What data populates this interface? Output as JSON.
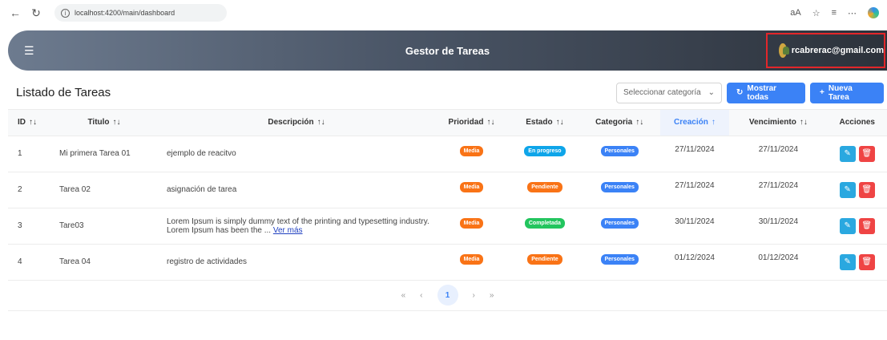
{
  "browser": {
    "url": "localhost:4200/main/dashboard",
    "right_icons": [
      "aA",
      "☆",
      "≡",
      "⋯"
    ]
  },
  "header": {
    "title": "Gestor de Tareas",
    "user_email": "rcabrerac@gmail.com"
  },
  "toolbar": {
    "title": "Listado de Tareas",
    "category_placeholder": "Seleccionar categoría",
    "show_all_label": "Mostrar todas",
    "new_task_label": "Nueva Tarea"
  },
  "table": {
    "columns": [
      "ID",
      "Titulo",
      "Descripción",
      "Prioridad",
      "Estado",
      "Categoria",
      "Creación",
      "Vencimiento",
      "Acciones"
    ],
    "sorted_column": "Creación",
    "rows": [
      {
        "id": "1",
        "title": "Mi primera Tarea 01",
        "desc": "ejemplo de reacitvo",
        "more": "",
        "priority": "Media",
        "status": "En progreso",
        "category": "Personales",
        "created": "27/11/2024",
        "due": "27/11/2024"
      },
      {
        "id": "2",
        "title": "Tarea 02",
        "desc": "asignación de tarea",
        "more": "",
        "priority": "Media",
        "status": "Pendiente",
        "category": "Personales",
        "created": "27/11/2024",
        "due": "27/11/2024"
      },
      {
        "id": "3",
        "title": "Tare03",
        "desc": "Lorem Ipsum is simply dummy text of the printing and typesetting industry. Lorem Ipsum has been the ...",
        "more": "Ver más",
        "priority": "Media",
        "status": "Completada",
        "category": "Personales",
        "created": "30/11/2024",
        "due": "30/11/2024"
      },
      {
        "id": "4",
        "title": "Tarea 04",
        "desc": "registro de actividades",
        "more": "",
        "priority": "Media",
        "status": "Pendiente",
        "category": "Personales",
        "created": "01/12/2024",
        "due": "01/12/2024"
      }
    ]
  },
  "pagination": {
    "first": "«",
    "prev": "‹",
    "current": "1",
    "next": "›",
    "last": "»"
  },
  "colors": {
    "priority_media": "#f97316",
    "status_en_progreso": "#0ea5e9",
    "status_pendiente": "#f97316",
    "status_completada": "#22c55e",
    "category_personales": "#3b82f6",
    "accent": "#3b82f6"
  }
}
